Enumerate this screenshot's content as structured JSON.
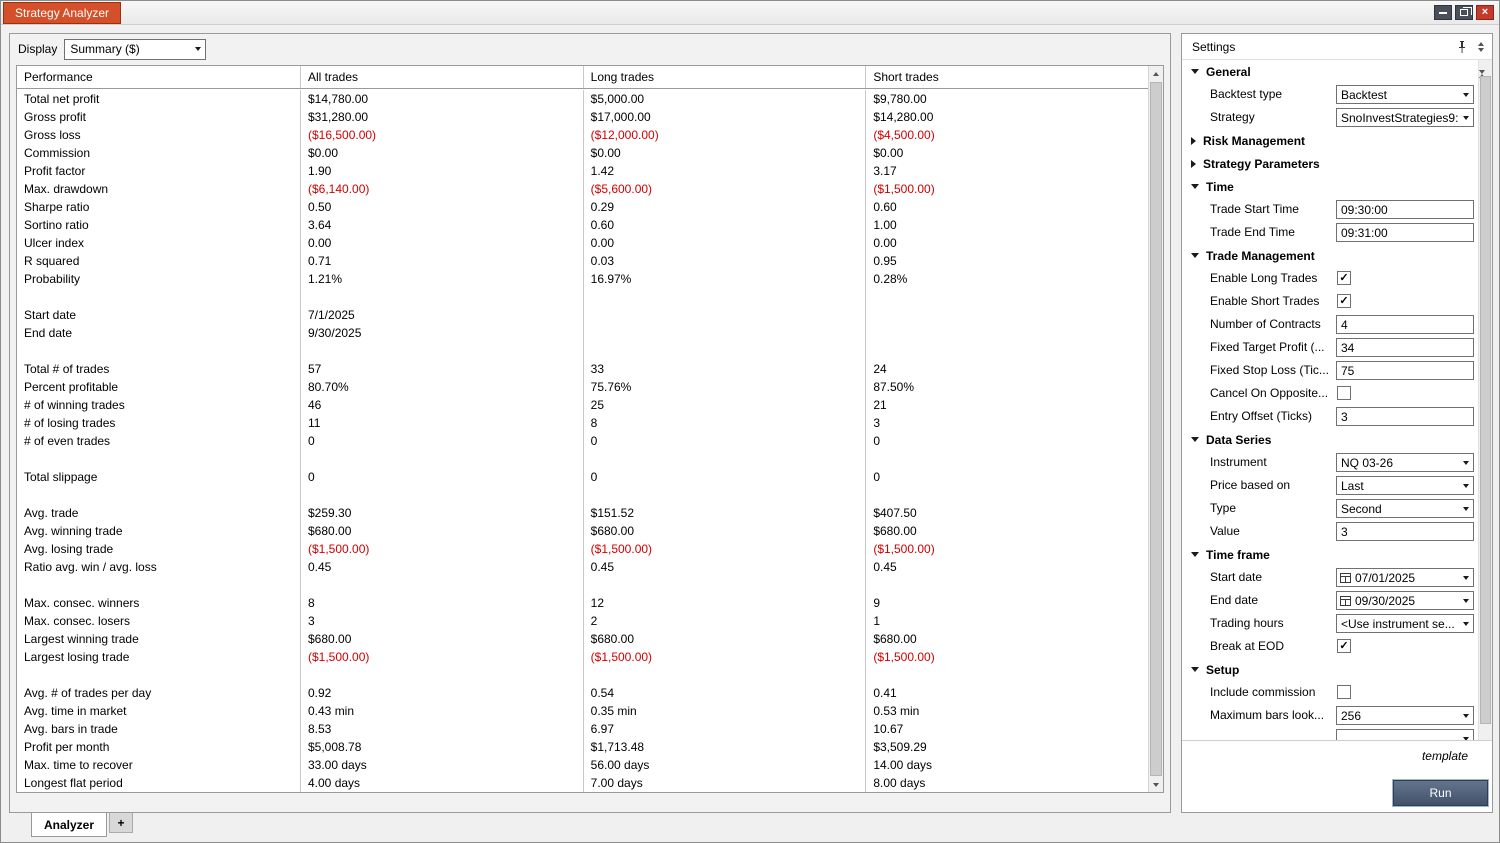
{
  "colors": {
    "accent_orange": "#d4502a",
    "negative_red": "#d00000",
    "run_button": "#41526a"
  },
  "window": {
    "title": "Strategy Analyzer"
  },
  "toolbar": {
    "display_label": "Display",
    "display_value": "Summary ($)"
  },
  "table": {
    "columns": [
      "Performance",
      "All trades",
      "Long trades",
      "Short trades"
    ],
    "rows": [
      {
        "label": "Total net profit",
        "values": [
          "$14,780.00",
          "$5,000.00",
          "$9,780.00"
        ]
      },
      {
        "label": "Gross profit",
        "values": [
          "$31,280.00",
          "$17,000.00",
          "$14,280.00"
        ]
      },
      {
        "label": "Gross loss",
        "values": [
          "($16,500.00)",
          "($12,000.00)",
          "($4,500.00)"
        ]
      },
      {
        "label": "Commission",
        "values": [
          "$0.00",
          "$0.00",
          "$0.00"
        ]
      },
      {
        "label": "Profit factor",
        "values": [
          "1.90",
          "1.42",
          "3.17"
        ]
      },
      {
        "label": "Max. drawdown",
        "values": [
          "($6,140.00)",
          "($5,600.00)",
          "($1,500.00)"
        ]
      },
      {
        "label": "Sharpe ratio",
        "values": [
          "0.50",
          "0.29",
          "0.60"
        ]
      },
      {
        "label": "Sortino ratio",
        "values": [
          "3.64",
          "0.60",
          "1.00"
        ]
      },
      {
        "label": "Ulcer index",
        "values": [
          "0.00",
          "0.00",
          "0.00"
        ]
      },
      {
        "label": "R squared",
        "values": [
          "0.71",
          "0.03",
          "0.95"
        ]
      },
      {
        "label": "Probability",
        "values": [
          "1.21%",
          "16.97%",
          "0.28%"
        ]
      },
      {
        "label": "",
        "values": [
          "",
          "",
          ""
        ]
      },
      {
        "label": "Start date",
        "values": [
          "7/1/2025",
          "",
          ""
        ]
      },
      {
        "label": "End date",
        "values": [
          "9/30/2025",
          "",
          ""
        ]
      },
      {
        "label": "",
        "values": [
          "",
          "",
          ""
        ]
      },
      {
        "label": "Total # of trades",
        "values": [
          "57",
          "33",
          "24"
        ]
      },
      {
        "label": "Percent profitable",
        "values": [
          "80.70%",
          "75.76%",
          "87.50%"
        ]
      },
      {
        "label": "# of winning trades",
        "values": [
          "46",
          "25",
          "21"
        ]
      },
      {
        "label": "# of losing trades",
        "values": [
          "11",
          "8",
          "3"
        ]
      },
      {
        "label": "# of even trades",
        "values": [
          "0",
          "0",
          "0"
        ]
      },
      {
        "label": "",
        "values": [
          "",
          "",
          ""
        ]
      },
      {
        "label": "Total slippage",
        "values": [
          "0",
          "0",
          "0"
        ]
      },
      {
        "label": "",
        "values": [
          "",
          "",
          ""
        ]
      },
      {
        "label": "Avg. trade",
        "values": [
          "$259.30",
          "$151.52",
          "$407.50"
        ]
      },
      {
        "label": "Avg. winning trade",
        "values": [
          "$680.00",
          "$680.00",
          "$680.00"
        ]
      },
      {
        "label": "Avg. losing trade",
        "values": [
          "($1,500.00)",
          "($1,500.00)",
          "($1,500.00)"
        ]
      },
      {
        "label": "Ratio avg. win / avg. loss",
        "values": [
          "0.45",
          "0.45",
          "0.45"
        ]
      },
      {
        "label": "",
        "values": [
          "",
          "",
          ""
        ]
      },
      {
        "label": "Max. consec. winners",
        "values": [
          "8",
          "12",
          "9"
        ]
      },
      {
        "label": "Max. consec. losers",
        "values": [
          "3",
          "2",
          "1"
        ]
      },
      {
        "label": "Largest winning trade",
        "values": [
          "$680.00",
          "$680.00",
          "$680.00"
        ]
      },
      {
        "label": "Largest losing trade",
        "values": [
          "($1,500.00)",
          "($1,500.00)",
          "($1,500.00)"
        ]
      },
      {
        "label": "",
        "values": [
          "",
          "",
          ""
        ]
      },
      {
        "label": "Avg. # of trades per day",
        "values": [
          "0.92",
          "0.54",
          "0.41"
        ]
      },
      {
        "label": "Avg. time in market",
        "values": [
          "0.43 min",
          "0.35 min",
          "0.53 min"
        ]
      },
      {
        "label": "Avg. bars in trade",
        "values": [
          "8.53",
          "6.97",
          "10.67"
        ]
      },
      {
        "label": "Profit per month",
        "values": [
          "$5,008.78",
          "$1,713.48",
          "$3,509.29"
        ]
      },
      {
        "label": "Max. time to recover",
        "values": [
          "33.00 days",
          "56.00 days",
          "14.00 days"
        ]
      },
      {
        "label": "Longest flat period",
        "values": [
          "4.00 days",
          "7.00 days",
          "8.00 days"
        ]
      }
    ]
  },
  "bottom_tabs": {
    "analyzer": "Analyzer",
    "add": "+"
  },
  "settings": {
    "title": "Settings",
    "template_label": "template",
    "run_label": "Run",
    "sections": [
      {
        "label": "General",
        "expanded": true,
        "rows": [
          {
            "label": "Backtest type",
            "control": "select",
            "value": "Backtest"
          },
          {
            "label": "Strategy",
            "control": "select",
            "value": "SnoInvestStrategies9:"
          }
        ]
      },
      {
        "label": "Risk Management",
        "expanded": false,
        "rows": []
      },
      {
        "label": "Strategy Parameters",
        "expanded": false,
        "rows": []
      },
      {
        "label": "Time",
        "expanded": true,
        "rows": [
          {
            "label": "Trade Start Time",
            "control": "input",
            "value": "09:30:00"
          },
          {
            "label": "Trade End Time",
            "control": "input",
            "value": "09:31:00"
          }
        ]
      },
      {
        "label": "Trade Management",
        "expanded": true,
        "rows": [
          {
            "label": "Enable Long Trades",
            "control": "checkbox",
            "checked": true
          },
          {
            "label": "Enable Short Trades",
            "control": "checkbox",
            "checked": true
          },
          {
            "label": "Number of Contracts",
            "control": "input",
            "value": "4"
          },
          {
            "label": "Fixed Target Profit (...",
            "control": "input",
            "value": "34"
          },
          {
            "label": "Fixed Stop Loss (Tic...",
            "control": "input",
            "value": "75"
          },
          {
            "label": "Cancel On Opposite...",
            "control": "checkbox",
            "checked": false
          },
          {
            "label": "Entry Offset (Ticks)",
            "control": "input",
            "value": "3"
          }
        ]
      },
      {
        "label": "Data Series",
        "expanded": true,
        "rows": [
          {
            "label": "Instrument",
            "control": "select",
            "value": "NQ 03-26"
          },
          {
            "label": "Price based on",
            "control": "select",
            "value": "Last"
          },
          {
            "label": "Type",
            "control": "select",
            "value": "Second"
          },
          {
            "label": "Value",
            "control": "input",
            "value": "3"
          }
        ]
      },
      {
        "label": "Time frame",
        "expanded": true,
        "rows": [
          {
            "label": "Start date",
            "control": "date",
            "value": "07/01/2025"
          },
          {
            "label": "End date",
            "control": "date",
            "value": "09/30/2025"
          },
          {
            "label": "Trading hours",
            "control": "select",
            "value": "<Use instrument se..."
          },
          {
            "label": "Break at EOD",
            "control": "checkbox",
            "checked": true
          }
        ]
      },
      {
        "label": "Setup",
        "expanded": true,
        "rows": [
          {
            "label": "Include commission",
            "control": "checkbox",
            "checked": false
          },
          {
            "label": "Maximum bars look...",
            "control": "select",
            "value": "256"
          },
          {
            "label": "",
            "control": "select",
            "value": ""
          }
        ]
      }
    ]
  }
}
